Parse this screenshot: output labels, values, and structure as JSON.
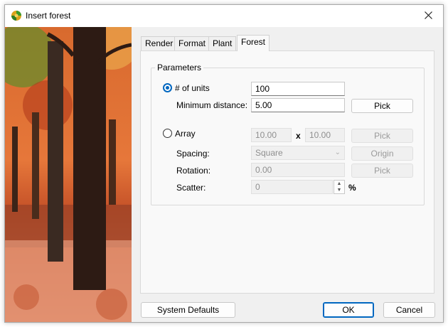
{
  "window": {
    "title": "Insert forest",
    "app_icon": "forest-tree-icon",
    "close_icon": "close-icon"
  },
  "tabs": [
    {
      "label": "Render",
      "active": false
    },
    {
      "label": "Format",
      "active": false
    },
    {
      "label": "Plant",
      "active": false
    },
    {
      "label": "Forest",
      "active": true
    }
  ],
  "parameters": {
    "group_label": "Parameters",
    "units": {
      "label": "# of units",
      "selected": true,
      "value": "100",
      "min_distance_label": "Minimum distance:",
      "min_distance_value": "5.00",
      "pick_label": "Pick"
    },
    "array": {
      "label": "Array",
      "selected": false,
      "x_value": "10.00",
      "separator": "x",
      "y_value": "10.00",
      "pick_label": "Pick",
      "spacing_label": "Spacing:",
      "spacing_value": "Square",
      "origin_label": "Origin",
      "rotation_label": "Rotation:",
      "rotation_value": "0.00",
      "rotation_pick_label": "Pick",
      "scatter_label": "Scatter:",
      "scatter_value": "0",
      "scatter_unit": "%"
    }
  },
  "buttons": {
    "system_defaults": "System Defaults",
    "ok": "OK",
    "cancel": "Cancel"
  },
  "colors": {
    "accent": "#0067c0",
    "dialog_bg": "#f0f0f0",
    "panel_bg": "#f9f9f9"
  }
}
